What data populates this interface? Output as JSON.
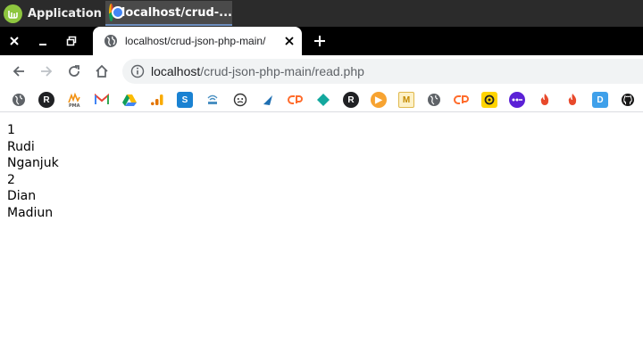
{
  "taskbar": {
    "app_menu_label": "Application",
    "task_title": "localhost/crud-...",
    "icons": {
      "menu": "linux-mint-icon",
      "task": "chrome-icon"
    }
  },
  "browser": {
    "tab": {
      "title": "localhost/crud-json-php-main/"
    },
    "address": {
      "host": "localhost",
      "path": "/crud-json-php-main/read.php"
    },
    "bookmarks": [
      "globe-icon",
      "r-icon",
      "pma-icon",
      "gmail-icon",
      "drive-icon",
      "analytics-icon",
      "s-icon",
      "router-icon",
      "face-icon",
      "arrow-icon",
      "cpanel-icon",
      "diamond-icon",
      "r-icon",
      "o-icon",
      "m-icon",
      "globe-icon",
      "cpanel-icon",
      "wheel-icon",
      "dots-icon",
      "flame-icon",
      "flame-icon",
      "flame-icon",
      "d-icon",
      "github-icon"
    ]
  },
  "page": {
    "lines": [
      "1",
      "Rudi",
      "Nganjuk",
      "2",
      "Dian",
      "Madiun"
    ]
  }
}
